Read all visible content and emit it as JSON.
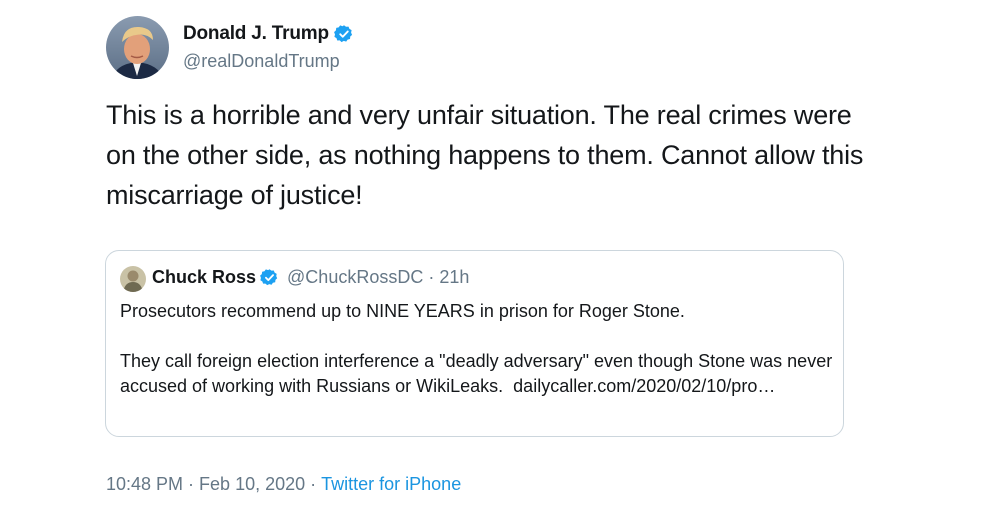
{
  "author": {
    "display_name": "Donald J. Trump",
    "handle": "@realDonaldTrump",
    "verified": true,
    "avatar_icon": "profile-photo"
  },
  "tweet": {
    "text": "This is a horrible and very unfair situation. The real crimes were on the other side, as nothing happens to them. Cannot allow this miscarriage of justice!"
  },
  "quoted_tweet": {
    "display_name": "Chuck Ross",
    "handle": "@ChuckRossDC",
    "time": "21h",
    "separator": "·",
    "verified": true,
    "paragraph_1": "Prosecutors recommend up to NINE YEARS in prison for Roger Stone.",
    "paragraph_2": "They call foreign election interference a \"deadly adversary\" even though Stone was never accused of working with Russians or WikiLeaks.",
    "link_text": "dailycaller.com/2020/02/10/pro…"
  },
  "meta": {
    "time": "10:48 PM",
    "separator": "·",
    "date": "Feb 10, 2020",
    "source": "Twitter for iPhone"
  },
  "colors": {
    "text": "#14171a",
    "secondary": "#657786",
    "link": "#1b95e0",
    "verified": "#1da1f2",
    "border": "#ccd6dd"
  }
}
